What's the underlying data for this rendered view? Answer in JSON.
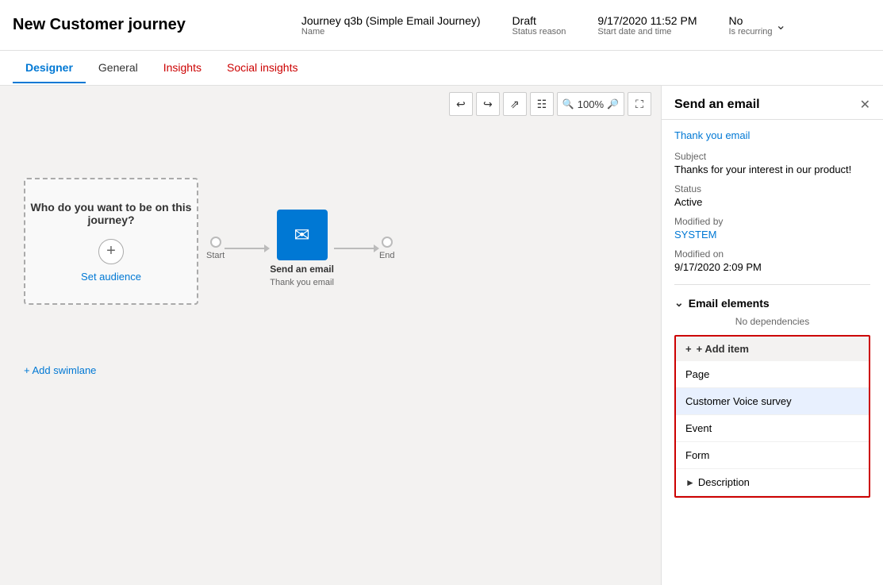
{
  "header": {
    "title": "New Customer journey",
    "meta": {
      "name_value": "Journey q3b (Simple Email Journey)",
      "name_label": "Name",
      "status_value": "Draft",
      "status_label": "Status reason",
      "start_value": "9/17/2020 11:52 PM",
      "start_label": "Start date and time",
      "recurring_value": "No",
      "recurring_label": "Is recurring"
    }
  },
  "tabs": [
    {
      "id": "designer",
      "label": "Designer",
      "active": true
    },
    {
      "id": "general",
      "label": "General",
      "active": false
    },
    {
      "id": "insights",
      "label": "Insights",
      "active": false
    },
    {
      "id": "social-insights",
      "label": "Social insights",
      "active": false
    }
  ],
  "toolbar": {
    "undo": "↩",
    "redo": "↪",
    "zoom_in": "⤢",
    "columns": "⊞",
    "zoom_level": "100%",
    "zoom_out_icon": "🔍",
    "zoom_in_icon": "🔍",
    "fullscreen": "⛶"
  },
  "canvas": {
    "audience_text": "Who do you want to be on this journey?",
    "audience_link": "Set audience",
    "start_label": "Start",
    "end_label": "End",
    "email_node_label": "Send an email",
    "email_node_sublabel": "Thank you email",
    "add_swimlane": "+ Add swimlane"
  },
  "right_panel": {
    "title": "Send an email",
    "email_link": "Thank you email",
    "subject_label": "Subject",
    "subject_value": "Thanks for your interest in our product!",
    "status_label": "Status",
    "status_value": "Active",
    "modified_by_label": "Modified by",
    "modified_by_value": "SYSTEM",
    "modified_on_label": "Modified on",
    "modified_on_value": "9/17/2020 2:09 PM",
    "email_elements_label": "Email elements",
    "no_deps": "No dependencies",
    "add_item_label": "+ Add item",
    "dropdown_items": [
      {
        "id": "page",
        "label": "Page",
        "highlighted": false
      },
      {
        "id": "customer-voice",
        "label": "Customer Voice survey",
        "highlighted": true
      },
      {
        "id": "event",
        "label": "Event",
        "highlighted": false
      },
      {
        "id": "form",
        "label": "Form",
        "highlighted": false
      }
    ],
    "description_label": "Description"
  }
}
